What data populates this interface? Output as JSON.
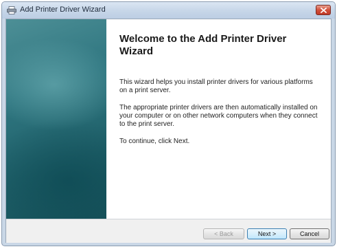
{
  "window": {
    "title": "Add Printer Driver Wizard",
    "title_icon": "printer-icon",
    "close_icon": "close-icon"
  },
  "content": {
    "heading": "Welcome to the Add Printer Driver Wizard",
    "paragraphs": [
      "This wizard helps you install printer drivers for various platforms on a print server.",
      "The appropriate printer drivers are then automatically installed on your computer or on other network computers when they connect to the print server.",
      "To continue, click Next."
    ]
  },
  "buttons": {
    "back": "< Back",
    "next": "Next >",
    "cancel": "Cancel"
  },
  "colors": {
    "banner": "#2f7680",
    "close_button": "#c13a27",
    "default_button_border": "#3c7fb1"
  }
}
